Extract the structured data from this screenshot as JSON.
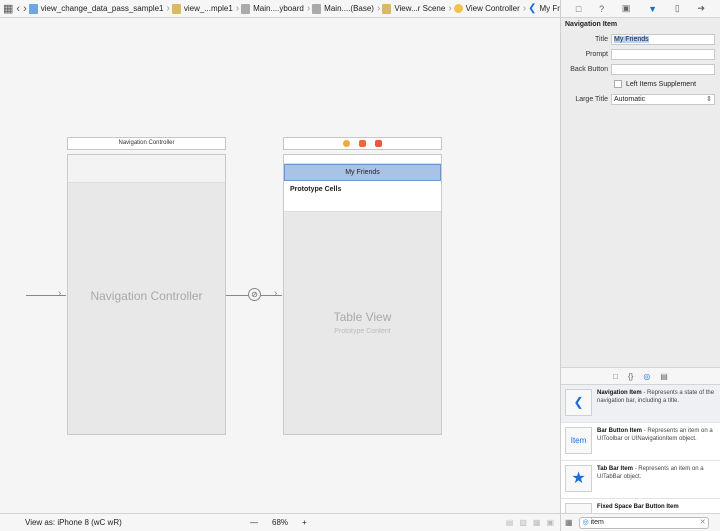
{
  "jumpbar": {
    "crumbs": [
      {
        "icon": "swift-file-icon",
        "label": "view_change_data_pass_sample1"
      },
      {
        "icon": "folder-icon",
        "label": "view_...mple1"
      },
      {
        "icon": "storyboard-icon",
        "label": "Main....yboard"
      },
      {
        "icon": "storyboard-icon",
        "label": "Main....(Base)"
      },
      {
        "icon": "scene-icon",
        "label": "View...r Scene"
      },
      {
        "icon": "view-controller-icon",
        "label": "View Controller"
      },
      {
        "icon": "back-chevron-icon",
        "label": "My Friends"
      }
    ]
  },
  "canvas": {
    "nav_scene_title": "Navigation Controller",
    "nav_controller_label": "Navigation Controller",
    "vc_navbar_title": "My Friends",
    "prototype_cells": "Prototype Cells",
    "table_view_label": "Table View",
    "table_view_sub": "Prototype Content",
    "scene_dock_colors": [
      "#f2a93b",
      "#e8683a",
      "#e65a3b"
    ]
  },
  "bottombar": {
    "view_as": "View as: iPhone 8 (ᴡC ᴡR)",
    "zoom_out": "—",
    "zoom_level": "68%",
    "zoom_in": "+"
  },
  "inspector": {
    "section_title": "Navigation Item",
    "title_label": "Title",
    "title_value": "My Friends",
    "prompt_label": "Prompt",
    "prompt_value": "",
    "back_button_label": "Back Button",
    "back_button_value": "",
    "left_items_label": "Left Items Supplement",
    "large_title_label": "Large Title",
    "large_title_value": "Automatic"
  },
  "library": {
    "items": [
      {
        "icon": "back-chevron-icon",
        "title": "Navigation Item",
        "desc": " - Represents a state of the navigation bar, including a title."
      },
      {
        "icon": "item-text-icon",
        "icon_text": "Item",
        "title": "Bar Button Item",
        "desc": " - Represents an item on a UIToolbar or UINavigationItem object."
      },
      {
        "icon": "star-icon",
        "title": "Tab Bar Item",
        "desc": " - Represents an item on a UITabBar object."
      },
      {
        "icon": "fixed-space-icon",
        "title": "Fixed Space Bar Button Item",
        "desc": ""
      }
    ],
    "filter_value": "item"
  },
  "colors": {
    "accent": "#1a6fd6",
    "navbar_fill": "#a9c3e6"
  }
}
